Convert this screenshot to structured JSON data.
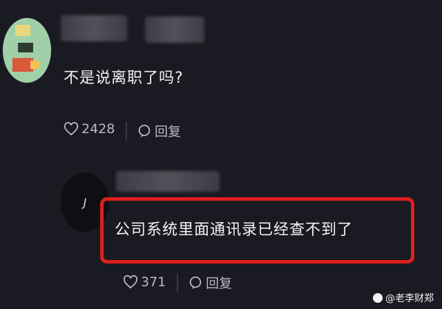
{
  "main_comment": {
    "text": "不是说离职了吗?",
    "like_count": "2428",
    "reply_label": "回复"
  },
  "reply_comment": {
    "avatar_initial": "J",
    "text": "公司系统里面通讯录已经查不到了",
    "like_count": "371",
    "reply_label": "回复"
  },
  "watermark": {
    "text": "@老李财郑"
  },
  "colors": {
    "background": "#1a1b22",
    "highlight_border": "#e11e1e",
    "meta_text": "#b9bac2"
  }
}
